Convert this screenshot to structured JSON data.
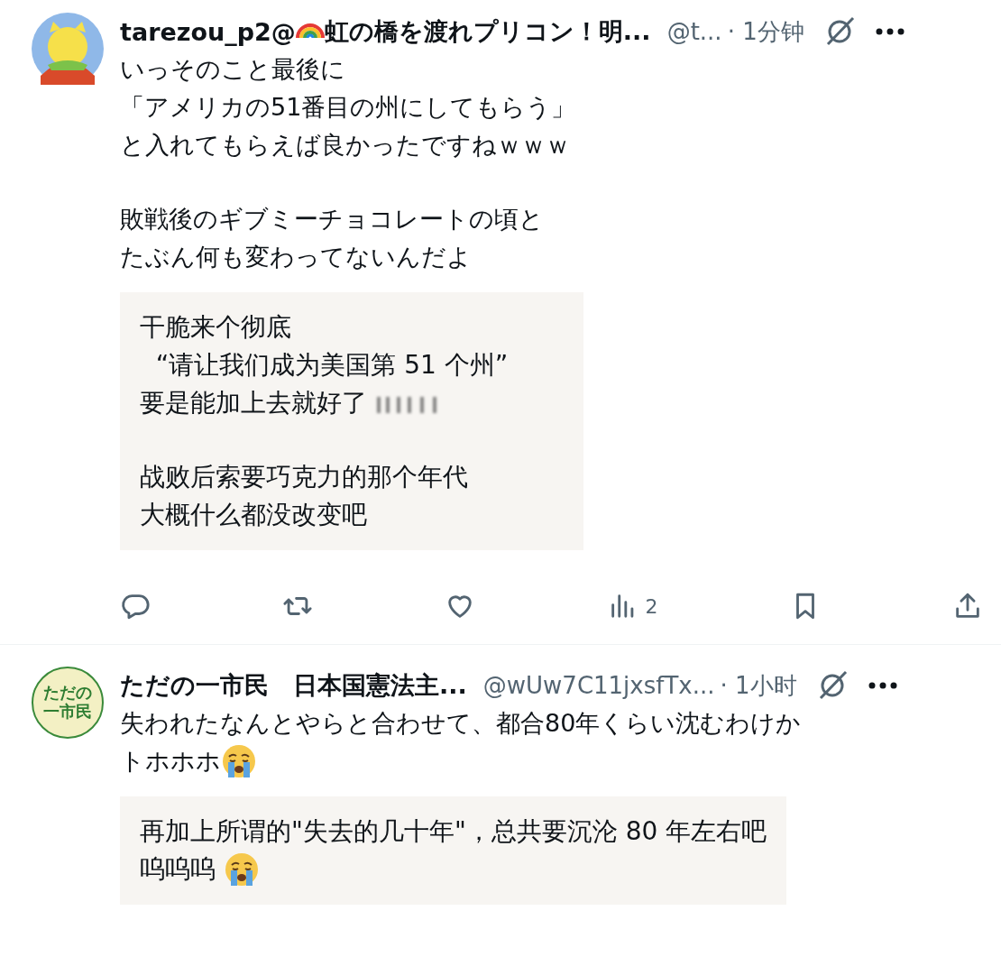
{
  "posts": [
    {
      "avatar": {
        "kind": "cartoon"
      },
      "name": [
        {
          "kind": "text",
          "text": "tarezou_p2@"
        },
        {
          "kind": "rainbow"
        },
        {
          "kind": "text",
          "text": "虹の橋を渡れプリコン！明..."
        }
      ],
      "handle": "@t...",
      "time": "· 1分钟",
      "body": [
        {
          "lines": [
            [
              {
                "kind": "text",
                "text": "いっそのこと最後に"
              }
            ],
            [
              {
                "kind": "text",
                "text": "「アメリカの51番目の州にしてもらう」"
              }
            ],
            [
              {
                "kind": "text",
                "text": "と入れてもらえば良かったですねｗｗｗ"
              }
            ]
          ]
        },
        {
          "lines": [
            [
              {
                "kind": "text",
                "text": "敗戦後のギブミーチョコレートの頃と"
              }
            ],
            [
              {
                "kind": "text",
                "text": "たぶん何も変わってないんだよ"
              }
            ]
          ]
        }
      ],
      "translation": [
        {
          "lines": [
            [
              {
                "kind": "text",
                "text": "干脆来个彻底"
              }
            ],
            [
              {
                "kind": "text",
                "text": "  “请让我们成为美国第 51 个州”"
              }
            ],
            [
              {
                "kind": "text",
                "text": "要是能加上去就好了 "
              },
              {
                "kind": "blurred"
              }
            ]
          ]
        },
        {
          "lines": [
            [
              {
                "kind": "text",
                "text": "战败后索要巧克力的那个年代"
              }
            ],
            [
              {
                "kind": "text",
                "text": "大概什么都没改变吧"
              }
            ]
          ]
        }
      ],
      "actions": [
        {
          "kind": "reply"
        },
        {
          "kind": "repost"
        },
        {
          "kind": "like"
        },
        {
          "kind": "views",
          "count": "2"
        },
        {
          "kind": "bookmark"
        },
        {
          "kind": "share"
        }
      ]
    },
    {
      "avatar": {
        "kind": "text",
        "lines": [
          "ただの",
          "一市民"
        ]
      },
      "name": [
        {
          "kind": "text",
          "text": "ただの一市民　日本国憲法主..."
        }
      ],
      "handle": "@wUw7C11jxsfTx...",
      "time": "· 1小时",
      "body": [
        {
          "lines": [
            [
              {
                "kind": "text",
                "text": "失われたなんとやらと合わせて、都合80年くらい沈むわけか"
              }
            ],
            [
              {
                "kind": "text",
                "text": "トホホホ"
              },
              {
                "kind": "emoji"
              }
            ]
          ]
        }
      ],
      "translation": [
        {
          "lines": [
            [
              {
                "kind": "text",
                "text": "再加上所谓的\"失去的几十年\"，总共要沉沦 80 年左右吧"
              }
            ],
            [
              {
                "kind": "text",
                "text": "呜呜呜 "
              },
              {
                "kind": "emoji"
              }
            ]
          ]
        }
      ]
    }
  ]
}
